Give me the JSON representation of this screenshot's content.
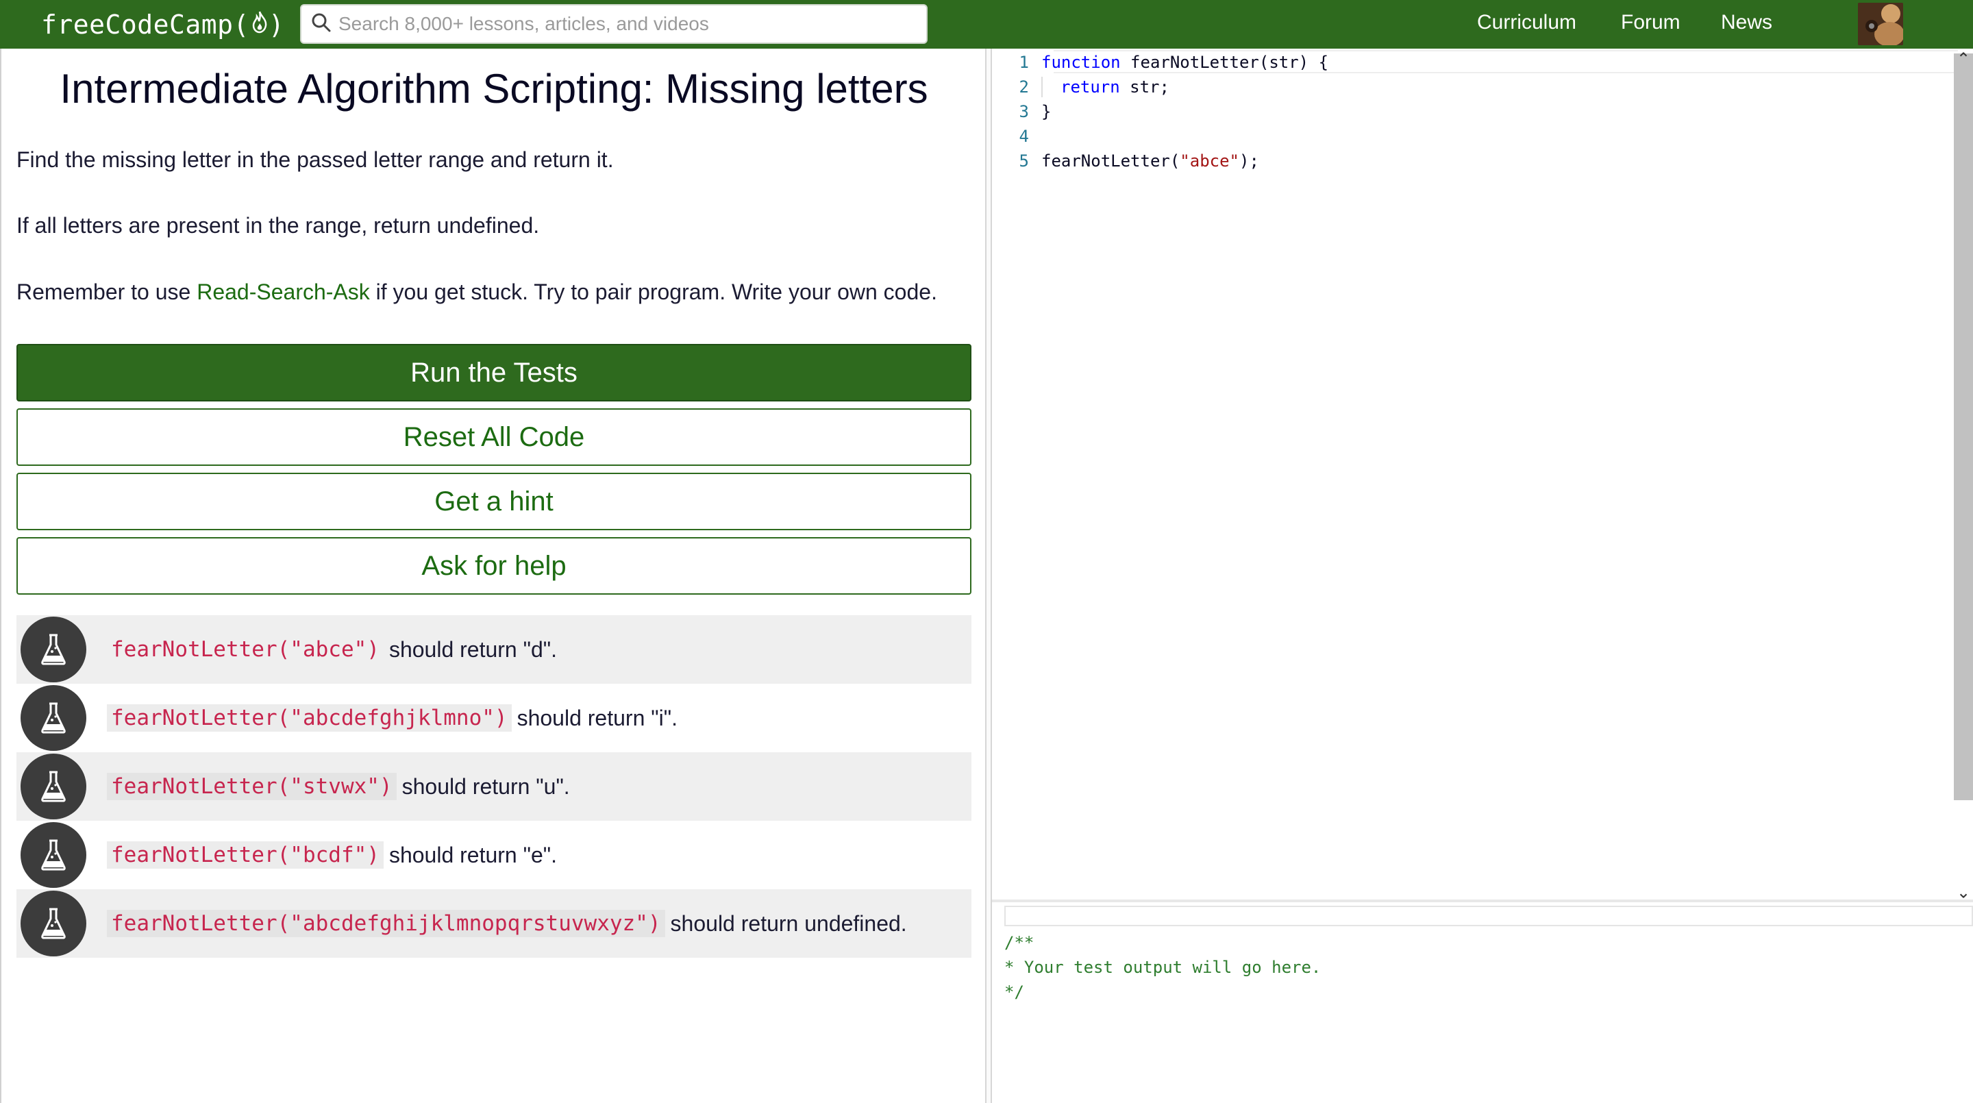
{
  "nav": {
    "logo_text": "freeCodeCamp(",
    "logo_close": ")",
    "search_placeholder": "Search 8,000+ lessons, articles, and videos",
    "links": [
      "Curriculum",
      "Forum",
      "News"
    ]
  },
  "challenge": {
    "title": "Intermediate Algorithm Scripting: Missing letters",
    "description_1": "Find the missing letter in the passed letter range and return it.",
    "description_2": "If all letters are present in the range, return undefined.",
    "help_prefix": "Remember to use ",
    "help_link": "Read-Search-Ask",
    "help_suffix": " if you get stuck. Try to pair program. Write your own code."
  },
  "buttons": {
    "run": "Run the Tests",
    "reset": "Reset All Code",
    "hint": "Get a hint",
    "help": "Ask for help"
  },
  "tests": [
    {
      "code": "fearNotLetter(\"abce\")",
      "text": "should return \"d\"."
    },
    {
      "code": "fearNotLetter(\"abcdefghjklmno\")",
      "text": "should return \"i\"."
    },
    {
      "code": "fearNotLetter(\"stvwx\")",
      "text": "should return \"u\"."
    },
    {
      "code": "fearNotLetter(\"bcdf\")",
      "text": "should return \"e\"."
    },
    {
      "code": "fearNotLetter(\"abcdefghijklmnopqrstuvwxyz\")",
      "text": "should return undefined."
    }
  ],
  "editor": {
    "line_numbers": [
      "1",
      "2",
      "3",
      "4",
      "5"
    ],
    "l1_kw": "function",
    "l1_rest": " fearNotLetter(str) {",
    "l2_kw": "return",
    "l2_rest": " str;",
    "l3": "}",
    "l5_fn": "fearNotLetter(",
    "l5_str": "\"abce\"",
    "l5_end": ");"
  },
  "output": {
    "text": "/**\n* Your test output will go here.\n*/"
  },
  "colors": {
    "brand_green": "#2e6a1e",
    "test_code": "#c7254e"
  }
}
